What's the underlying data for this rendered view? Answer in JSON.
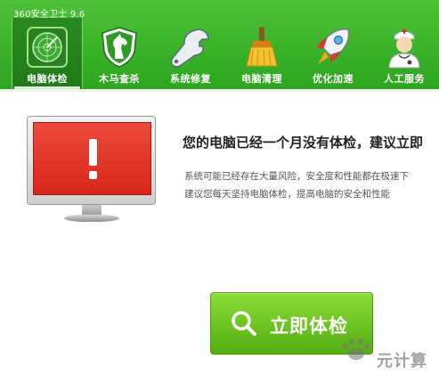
{
  "app": {
    "title": "360安全卫士 9.6"
  },
  "tabs": [
    {
      "label": "电脑体检",
      "icon": "radar-icon",
      "active": true
    },
    {
      "label": "木马查杀",
      "icon": "horse-shield-icon",
      "active": false
    },
    {
      "label": "系统修复",
      "icon": "wrench-icon",
      "active": false
    },
    {
      "label": "电脑清理",
      "icon": "broom-icon",
      "active": false
    },
    {
      "label": "优化加速",
      "icon": "rocket-icon",
      "active": false
    },
    {
      "label": "人工服务",
      "icon": "doctor-icon",
      "active": false
    }
  ],
  "main": {
    "headline": "您的电脑已经一个月没有体检，建议立即",
    "desc_line1": "系统可能已经存在大量风险，安全度和性能都在极速下",
    "desc_line2": "建议您每天坚持电脑体检，提高电脑的安全和性能",
    "check_button": "立即体检"
  },
  "watermark": {
    "text": "元计算"
  },
  "colors": {
    "brand_green": "#3ab229",
    "alert_red": "#e03a2c",
    "button_green": "#6ec523"
  }
}
